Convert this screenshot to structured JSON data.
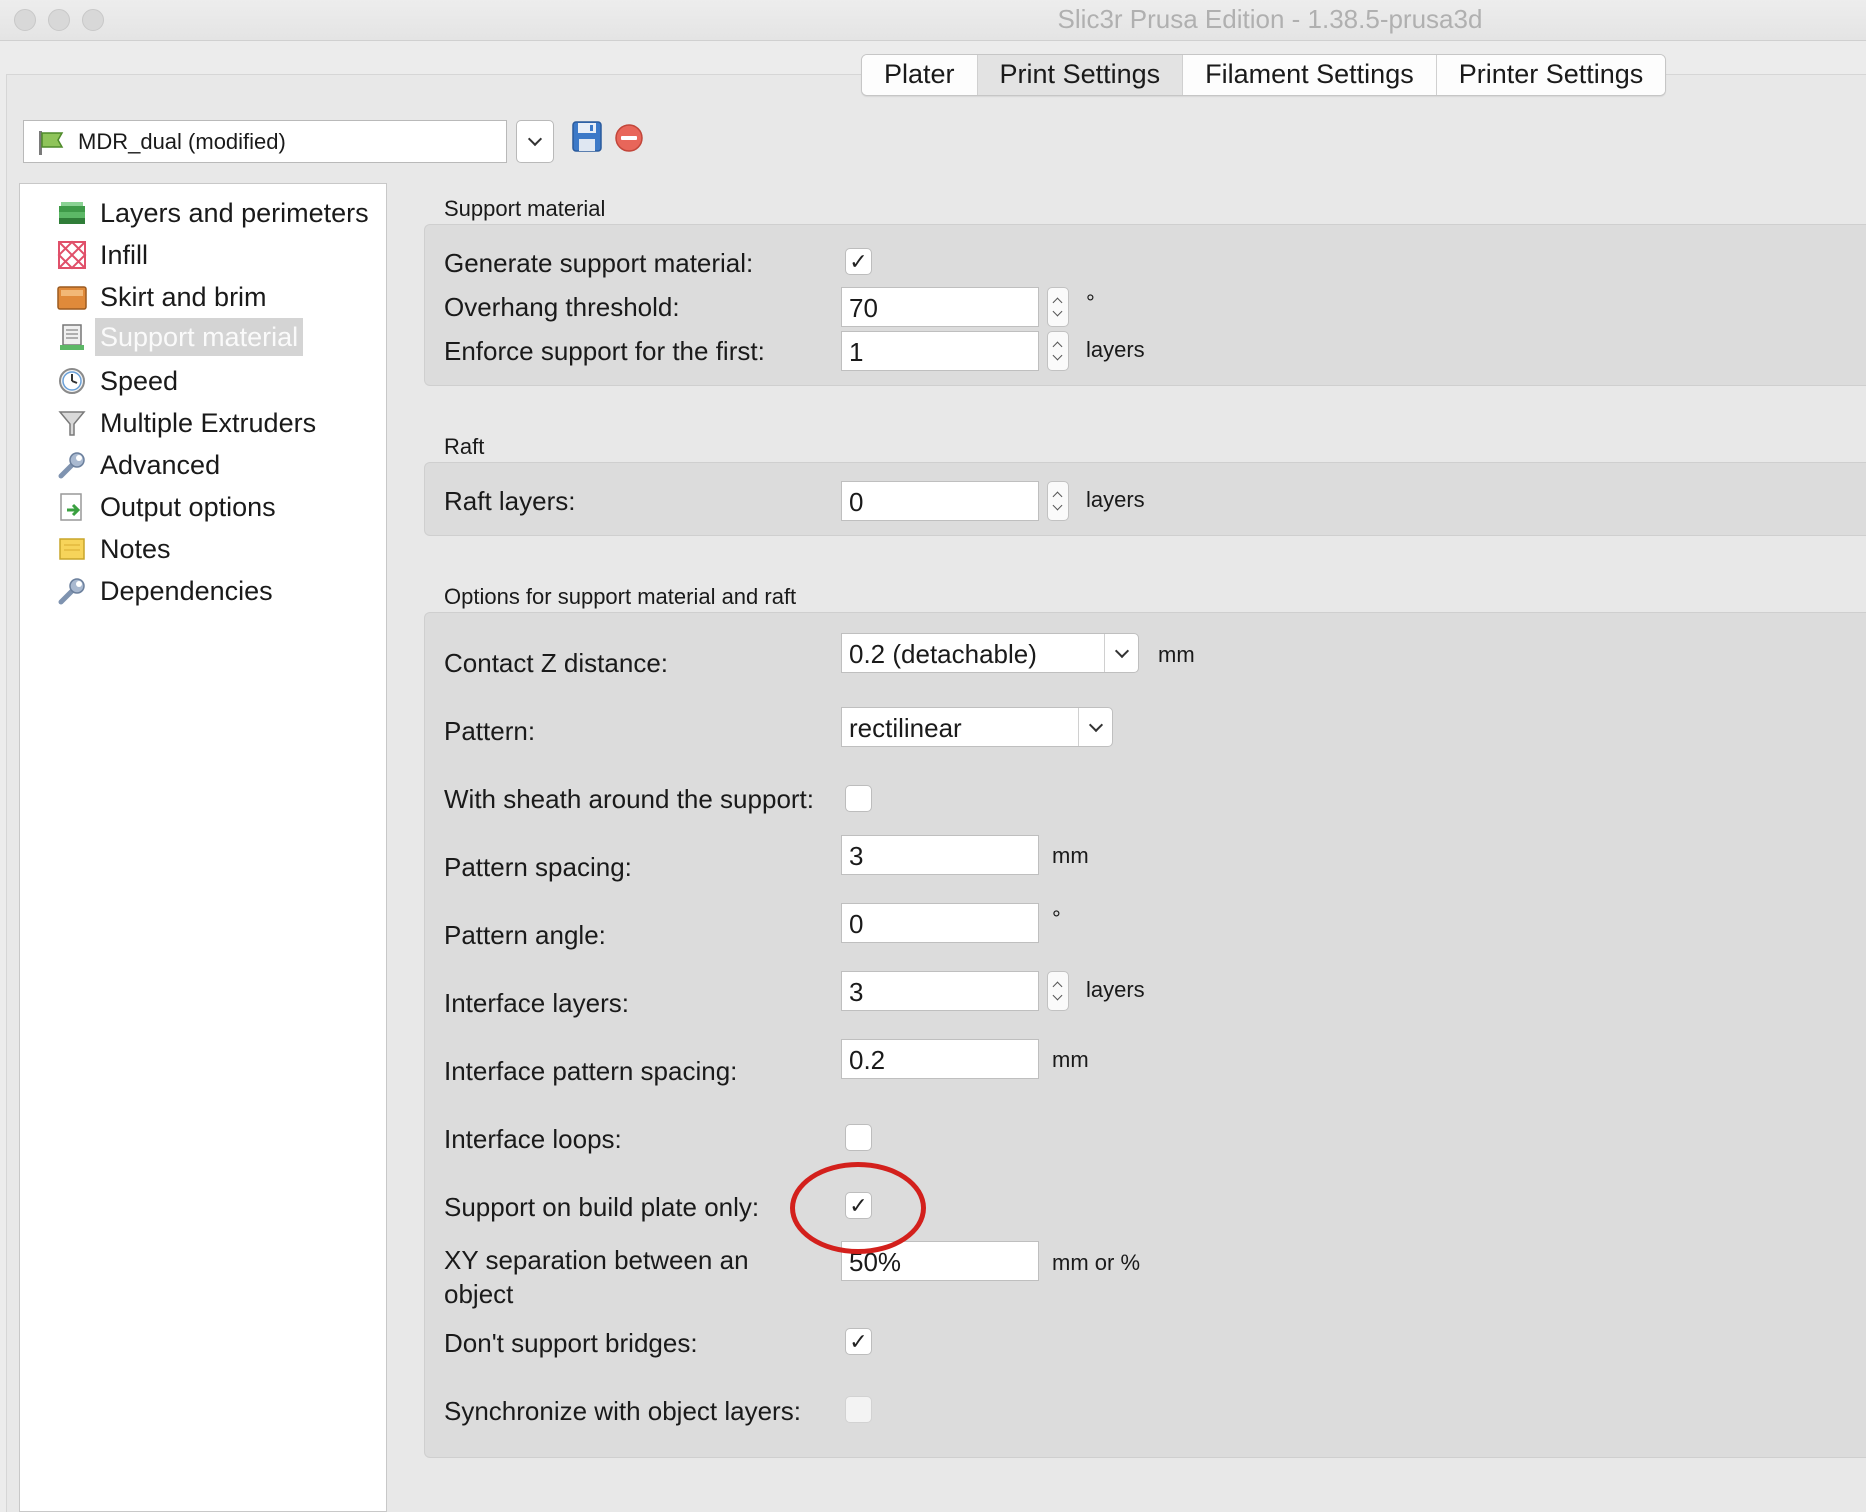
{
  "window": {
    "title": "Slic3r Prusa Edition - 1.38.5-prusa3d"
  },
  "tabs": [
    {
      "label": "Plater"
    },
    {
      "label": "Print Settings"
    },
    {
      "label": "Filament Settings"
    },
    {
      "label": "Printer Settings"
    }
  ],
  "preset": {
    "value": "MDR_dual (modified)",
    "icon": "flag-icon",
    "save_icon": "floppy-save-icon",
    "delete_icon": "red-minus-delete-icon"
  },
  "sidebar": {
    "items": [
      {
        "label": "Layers and perimeters",
        "icon": "layers-icon"
      },
      {
        "label": "Infill",
        "icon": "infill-icon"
      },
      {
        "label": "Skirt and brim",
        "icon": "skirt-icon"
      },
      {
        "label": "Support material",
        "icon": "support-icon",
        "selected": true
      },
      {
        "label": "Speed",
        "icon": "clock-icon"
      },
      {
        "label": "Multiple Extruders",
        "icon": "funnel-icon"
      },
      {
        "label": "Advanced",
        "icon": "wrench-icon"
      },
      {
        "label": "Output options",
        "icon": "output-icon"
      },
      {
        "label": "Notes",
        "icon": "note-icon"
      },
      {
        "label": "Dependencies",
        "icon": "wrench-icon"
      }
    ]
  },
  "support": {
    "section_title": "Support material",
    "generate_label": "Generate support material:",
    "generate_checked": true,
    "overhang_label": "Overhang threshold:",
    "overhang_value": "70",
    "overhang_unit": "°",
    "enforce_label": "Enforce support for the first:",
    "enforce_value": "1",
    "enforce_unit": "layers"
  },
  "raft": {
    "section_title": "Raft",
    "layers_label": "Raft layers:",
    "layers_value": "0",
    "layers_unit": "layers"
  },
  "options": {
    "section_title": "Options for support material and raft",
    "contact_z_label": "Contact Z distance:",
    "contact_z_value": "0.2 (detachable)",
    "contact_z_unit": "mm",
    "pattern_label": "Pattern:",
    "pattern_value": "rectilinear",
    "sheath_label": "With sheath around the support:",
    "sheath_checked": false,
    "spacing_label": "Pattern spacing:",
    "spacing_value": "3",
    "spacing_unit": "mm",
    "angle_label": "Pattern angle:",
    "angle_value": "0",
    "angle_unit": "°",
    "interface_layers_label": "Interface layers:",
    "interface_layers_value": "3",
    "interface_layers_unit": "layers",
    "interface_spacing_label": "Interface pattern spacing:",
    "interface_spacing_value": "0.2",
    "interface_spacing_unit": "mm",
    "interface_loops_label": "Interface loops:",
    "interface_loops_checked": false,
    "build_plate_label": "Support on build plate only:",
    "build_plate_checked": true,
    "xy_sep_label": "XY separation between an object",
    "xy_sep_value": "50%",
    "xy_sep_unit": "mm or %",
    "bridges_label": "Don't support bridges:",
    "bridges_checked": true,
    "sync_label": "Synchronize with object layers:",
    "sync_checked": false
  },
  "annotation": {
    "highlight_color": "#d3201c"
  },
  "colors": {
    "panel_bg": "#dcdcdc",
    "window_bg": "#e8e8e8",
    "selected_item_bg": "#d4d4d4"
  }
}
